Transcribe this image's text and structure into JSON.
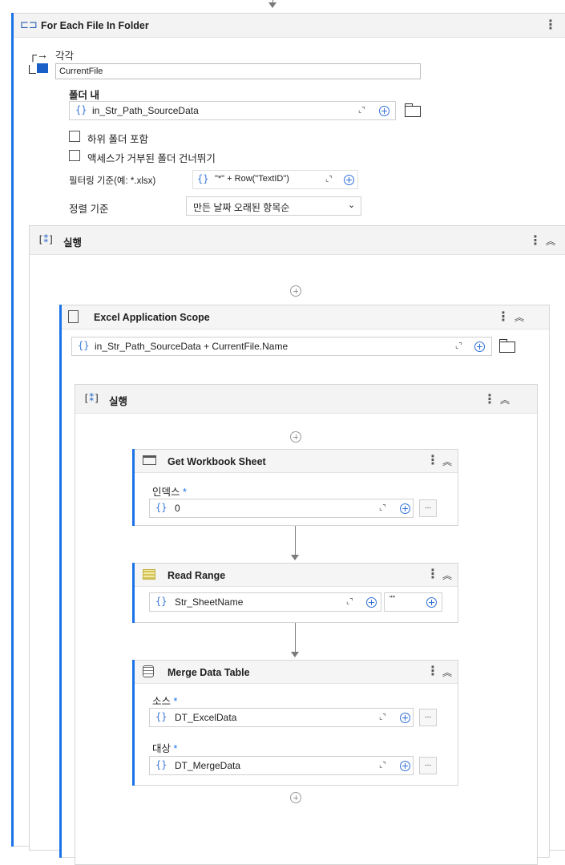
{
  "foreach": {
    "title": "For Each File In Folder",
    "each_label": "각각",
    "each_value": "CurrentFile",
    "folder_label": "폴더 내",
    "folder_value": "in_Str_Path_SourceData",
    "include_sub_label": "하위 폴더 포함",
    "skip_denied_label": "액세스가 거부된 폴더 건너뛰기",
    "filter_label": "필터링 기준(예: *.xlsx)",
    "filter_value": "\"*\" + Row(\"TextID\")",
    "sort_label": "정렬 기준",
    "sort_value": "만든 날짜 오래된 항목순"
  },
  "seq_outer": {
    "title": "실행"
  },
  "excel_scope": {
    "title": "Excel Application Scope",
    "path_value": "in_Str_Path_SourceData + CurrentFile.Name"
  },
  "seq_inner": {
    "title": "실행"
  },
  "get_sheet": {
    "title": "Get Workbook Sheet",
    "index_label": "인덱스",
    "index_value": "0"
  },
  "read_range": {
    "title": "Read Range",
    "sheet_value": "Str_SheetName",
    "range_value": "\"\""
  },
  "merge": {
    "title": "Merge Data Table",
    "source_label": "소스",
    "source_value": "DT_ExcelData",
    "target_label": "대상",
    "target_value": "DT_MergeData"
  },
  "common": {
    "brace": "{}",
    "required_mark": "*",
    "ellipsis": "...",
    "expand_glyph": "⌞⌝",
    "kebab": "⋮",
    "collapse_glyph": "︽"
  },
  "colors": {
    "accent": "#1a73e8",
    "brace": "#3b78d8",
    "header_bg": "#f3f3f3"
  }
}
